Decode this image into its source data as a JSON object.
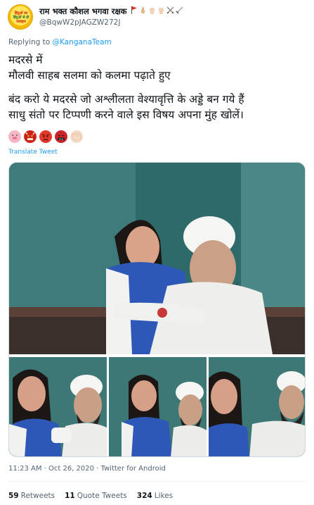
{
  "user": {
    "display_name": "राम भक्त कौशल भगवा रक्षक",
    "handle": "@BqwW2pJAGZW272J",
    "avatar_text": [
      "हिंदुओं का",
      "व्यवहार",
      "हिंदुओं से ही"
    ],
    "name_emojis": [
      "red-flag",
      "folded-hands",
      "raised-fist",
      "raised-fist",
      "crossed-swords",
      "dagger"
    ]
  },
  "replying": {
    "prefix": "Replying to",
    "mention": "@KanganaTeam"
  },
  "tweet": {
    "lines": [
      "मदरसे में",
      "मौलवी साहब सलमा को कलमा पढ़ाते हुए",
      "बंद करो ये मदरसे जो अश्लीलता वेश्यावृत्ति के अड्डे बन गये हैं",
      "साधु संतो पर टिप्पणी करने वाले इस विषय अपना मुंह खोलें।"
    ],
    "trailing_emojis": [
      "pig-face-icon",
      "ogre-icon",
      "angry-face-icon",
      "cursing-face-icon",
      "fist-icon"
    ],
    "translate_label": "Translate Tweet"
  },
  "meta": {
    "timestamp": "11:23 AM · Oct 26, 2020 · Twitter for Android"
  },
  "stats": {
    "retweets_count": "59",
    "retweets_label": "Retweets",
    "quotes_count": "11",
    "quotes_label": "Quote Tweets",
    "likes_count": "324",
    "likes_label": "Likes"
  },
  "colors": {
    "link_blue": "#1d9bf0",
    "secondary_text": "#536471",
    "wall_teal": "#3a7273"
  }
}
